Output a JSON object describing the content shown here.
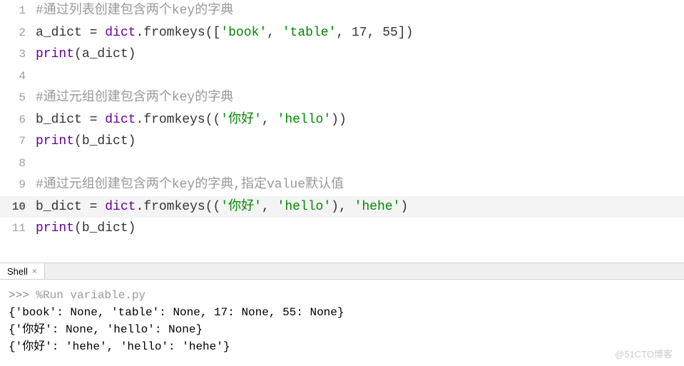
{
  "editor": {
    "lines": [
      {
        "num": "1",
        "tokens": [
          {
            "cls": "c-comment",
            "t": "#通过列表创建包含两个key的字典"
          }
        ]
      },
      {
        "num": "2",
        "tokens": [
          {
            "cls": "c-var",
            "t": "a_dict "
          },
          {
            "cls": "c-op",
            "t": "= "
          },
          {
            "cls": "c-builtin",
            "t": "dict"
          },
          {
            "cls": "c-dot",
            "t": "."
          },
          {
            "cls": "c-method",
            "t": "fromkeys"
          },
          {
            "cls": "c-paren",
            "t": "("
          },
          {
            "cls": "c-bracket",
            "t": "["
          },
          {
            "cls": "c-string",
            "t": "'book'"
          },
          {
            "cls": "c-comma",
            "t": ", "
          },
          {
            "cls": "c-string",
            "t": "'table'"
          },
          {
            "cls": "c-comma",
            "t": ", "
          },
          {
            "cls": "c-number",
            "t": "17"
          },
          {
            "cls": "c-comma",
            "t": ", "
          },
          {
            "cls": "c-number",
            "t": "55"
          },
          {
            "cls": "c-bracket",
            "t": "]"
          },
          {
            "cls": "c-paren",
            "t": ")"
          }
        ]
      },
      {
        "num": "3",
        "tokens": [
          {
            "cls": "c-print",
            "t": "print"
          },
          {
            "cls": "c-paren",
            "t": "("
          },
          {
            "cls": "c-var",
            "t": "a_dict"
          },
          {
            "cls": "c-paren",
            "t": ")"
          }
        ]
      },
      {
        "num": "4",
        "tokens": []
      },
      {
        "num": "5",
        "tokens": [
          {
            "cls": "c-comment",
            "t": "#通过元组创建包含两个key的字典"
          }
        ]
      },
      {
        "num": "6",
        "tokens": [
          {
            "cls": "c-var",
            "t": "b_dict "
          },
          {
            "cls": "c-op",
            "t": "= "
          },
          {
            "cls": "c-builtin",
            "t": "dict"
          },
          {
            "cls": "c-dot",
            "t": "."
          },
          {
            "cls": "c-method",
            "t": "fromkeys"
          },
          {
            "cls": "c-paren",
            "t": "(("
          },
          {
            "cls": "c-string",
            "t": "'你好'"
          },
          {
            "cls": "c-comma",
            "t": ", "
          },
          {
            "cls": "c-string",
            "t": "'hello'"
          },
          {
            "cls": "c-paren",
            "t": "))"
          }
        ]
      },
      {
        "num": "7",
        "tokens": [
          {
            "cls": "c-print",
            "t": "print"
          },
          {
            "cls": "c-paren",
            "t": "("
          },
          {
            "cls": "c-var",
            "t": "b_dict"
          },
          {
            "cls": "c-paren",
            "t": ")"
          }
        ]
      },
      {
        "num": "8",
        "tokens": []
      },
      {
        "num": "9",
        "tokens": [
          {
            "cls": "c-comment",
            "t": "#通过元组创建包含两个key的字典,指定value默认值"
          }
        ]
      },
      {
        "num": "10",
        "highlighted": true,
        "tokens": [
          {
            "cls": "c-var",
            "t": "b_dict "
          },
          {
            "cls": "c-op",
            "t": "= "
          },
          {
            "cls": "c-builtin",
            "t": "dict"
          },
          {
            "cls": "c-dot",
            "t": "."
          },
          {
            "cls": "c-method",
            "t": "fromkeys"
          },
          {
            "cls": "c-paren",
            "t": "(("
          },
          {
            "cls": "c-string",
            "t": "'你好'"
          },
          {
            "cls": "c-comma",
            "t": ", "
          },
          {
            "cls": "c-string",
            "t": "'hello'"
          },
          {
            "cls": "c-paren",
            "t": ")"
          },
          {
            "cls": "c-comma",
            "t": ", "
          },
          {
            "cls": "c-string",
            "t": "'hehe'"
          },
          {
            "cls": "c-paren",
            "t": ")"
          }
        ]
      },
      {
        "num": "11",
        "tokens": [
          {
            "cls": "c-print",
            "t": "print"
          },
          {
            "cls": "c-paren",
            "t": "("
          },
          {
            "cls": "c-var",
            "t": "b_dict"
          },
          {
            "cls": "c-paren",
            "t": ")"
          }
        ]
      }
    ],
    "current_line": "10"
  },
  "divider": {
    "tab_label": "Shell",
    "close_glyph": "×"
  },
  "shell": {
    "prompt": ">>> ",
    "magic_cmd": "%Run variable.py",
    "output_lines": [
      "{'book': None, 'table': None, 17: None, 55: None}",
      "{'你好': None, 'hello': None}",
      "{'你好': 'hehe', 'hello': 'hehe'}"
    ]
  },
  "watermark": "@51CTO博客"
}
